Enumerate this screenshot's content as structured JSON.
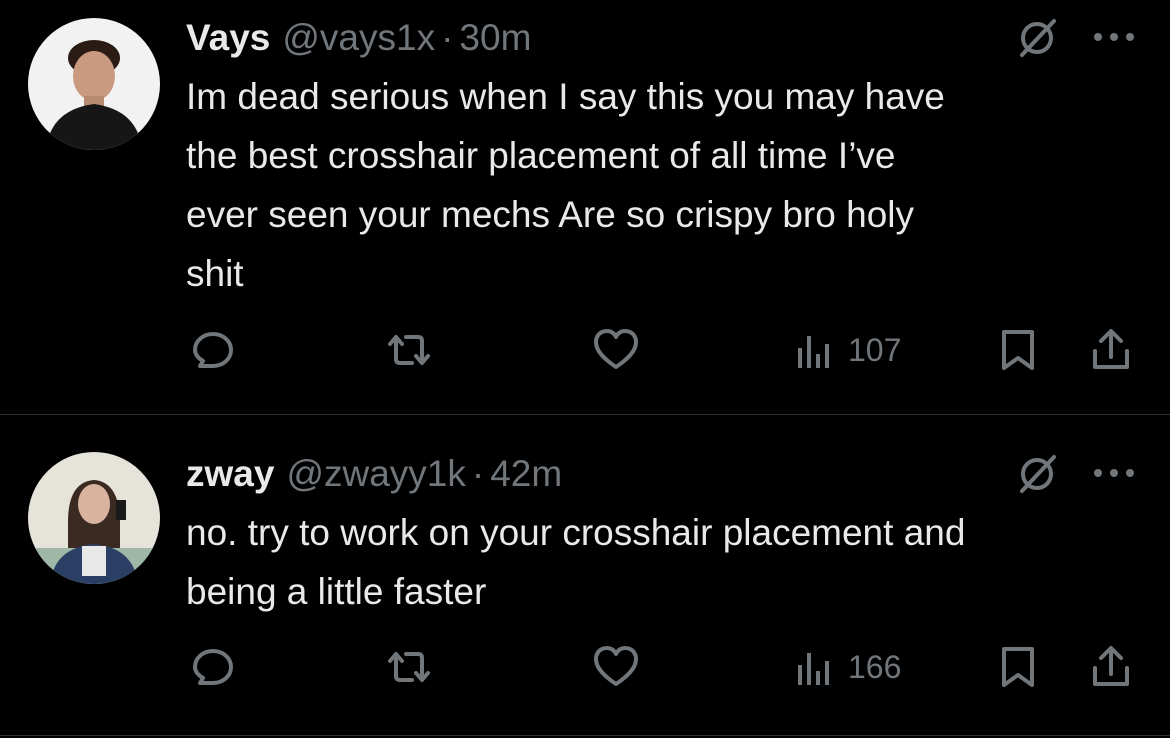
{
  "tweets": [
    {
      "display_name": "Vays",
      "handle": "@vays1x",
      "separator": "·",
      "time": "30m",
      "text": "Im dead serious when I say this you may have\nthe best crosshair placement of all time I’ve\never seen your mechs Are so crispy bro holy\nshit",
      "views": "107",
      "icons": [
        "reply-icon",
        "retweet-icon",
        "like-icon",
        "views-icon",
        "bookmark-icon",
        "share-icon",
        "grok-icon",
        "more-icon"
      ]
    },
    {
      "display_name": "zway",
      "handle": "@zwayy1k",
      "separator": "·",
      "time": "42m",
      "text": "no. try to work on your crosshair placement and\nbeing a little faster",
      "views": "166",
      "icons": [
        "reply-icon",
        "retweet-icon",
        "like-icon",
        "views-icon",
        "bookmark-icon",
        "share-icon",
        "grok-icon",
        "more-icon"
      ]
    }
  ],
  "colors": {
    "background": "#000000",
    "primary_text": "#e7e9ea",
    "secondary_text": "#71767b",
    "divider": "#2f3336"
  }
}
